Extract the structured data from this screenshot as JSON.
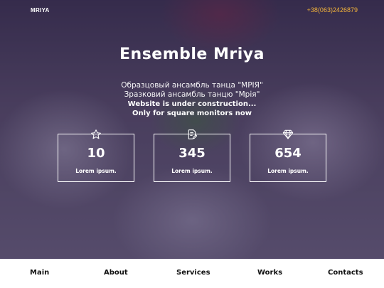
{
  "header": {
    "logo": "MRIYA",
    "phone": "+38(063)2426879"
  },
  "hero": {
    "title": "Ensemble Mriya",
    "subtitle_ru": "Образцовый ансамбль танца \"МРІЯ\"",
    "subtitle_ua": "Зразковий ансамбль танцю \"Мрія\"",
    "notice_line1": "Website is under construction...",
    "notice_line2": "Only for square monitors now"
  },
  "stats": [
    {
      "icon": "star-icon",
      "value": "10",
      "label": "Lorem ipsum."
    },
    {
      "icon": "document-edit-icon",
      "value": "345",
      "label": "Lorem ipsum."
    },
    {
      "icon": "diamond-icon",
      "value": "654",
      "label": "Lorem ipsum."
    }
  ],
  "nav": {
    "items": [
      "Main",
      "About",
      "Services",
      "Works",
      "Contacts"
    ]
  },
  "colors": {
    "phone": "#f2b33a",
    "overlay": "#2a1e46",
    "text": "#ffffff",
    "nav_text": "#111111"
  }
}
